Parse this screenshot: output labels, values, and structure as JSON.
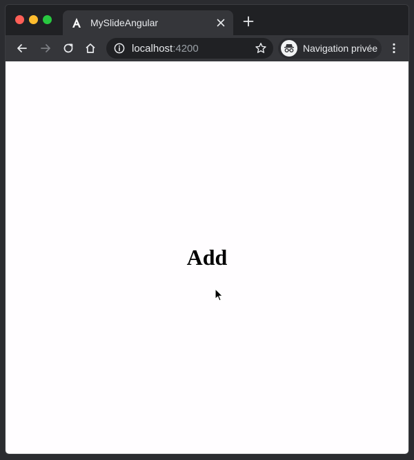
{
  "browser": {
    "tab": {
      "title": "MySlideAngular",
      "favicon": "angular-icon"
    },
    "address": {
      "host": "localhost",
      "port": ":4200"
    },
    "profile": {
      "label": "Navigation privée",
      "icon": "incognito-icon"
    }
  },
  "page": {
    "heading": "Add"
  },
  "colors": {
    "traffic_close": "#ff5f57",
    "traffic_min": "#febc2e",
    "traffic_max": "#28c840",
    "toolbar_bg": "#35363a",
    "tabstrip_bg": "#202124"
  }
}
